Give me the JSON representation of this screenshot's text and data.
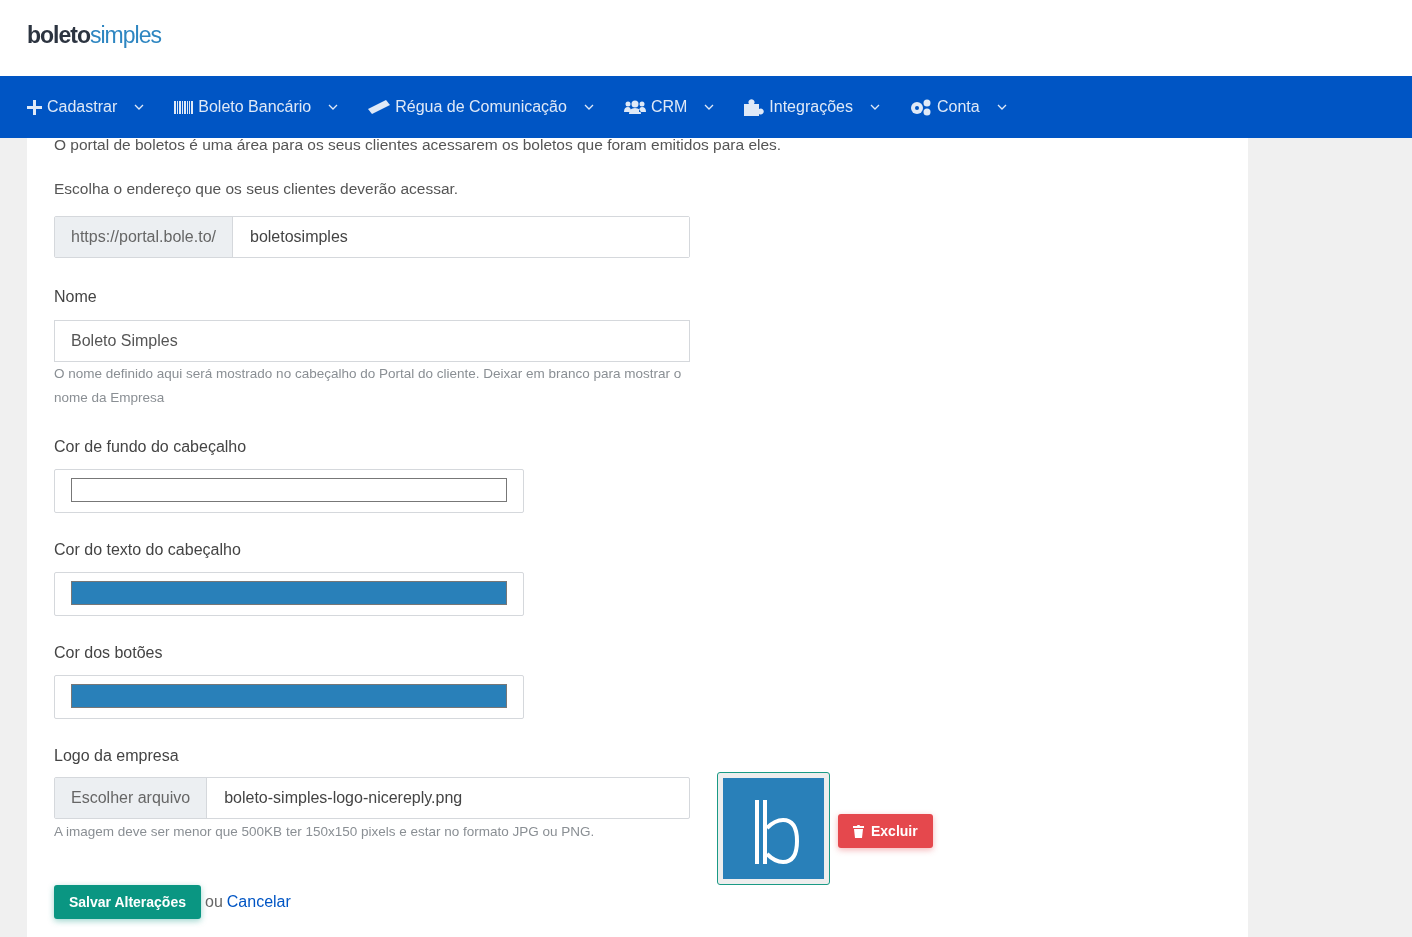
{
  "logo": "**boleto**simples",
  "nav": [
    {
      "label": "Cadastrar"
    },
    {
      "label": "Boleto Bancário"
    },
    {
      "label": "Régua de Comunicação"
    },
    {
      "label": "CRM"
    },
    {
      "label": "Integrações"
    },
    {
      "label": "Conta"
    }
  ],
  "intro": "O portal de boletos é uma área para os seus clientes acessarem os boletos que foram emitidos para eles.",
  "address_prompt": "Escolha o endereço que os seus clientes deverão acessar.",
  "address": {
    "prefix": "https://portal.bole.to/",
    "value": "boletosimples"
  },
  "name_field": {
    "label": "Nome",
    "value": "Boleto Simples",
    "help": "O nome definido aqui será mostrado no cabeçalho do Portal do cliente. Deixar em branco para mostrar o nome da Empresa"
  },
  "color_fields": [
    {
      "label": "Cor de fundo do cabeçalho",
      "color": "#ffffff"
    },
    {
      "label": "Cor do texto do cabeçalho",
      "color": "#2980b9"
    },
    {
      "label": "Cor dos botões",
      "color": "#2980b9"
    }
  ],
  "logo_field": {
    "label": "Logo da empresa",
    "button": "Escolher arquivo",
    "filename": "boleto-simples-logo-nicereply.png",
    "help": "A imagem deve ser menor que 500KB ter 150x150 pixels e estar no formato JPG ou PNG.",
    "delete": "Excluir"
  },
  "actions": {
    "save": "Salvar Alterações",
    "or": "ou",
    "cancel": "Cancelar"
  }
}
